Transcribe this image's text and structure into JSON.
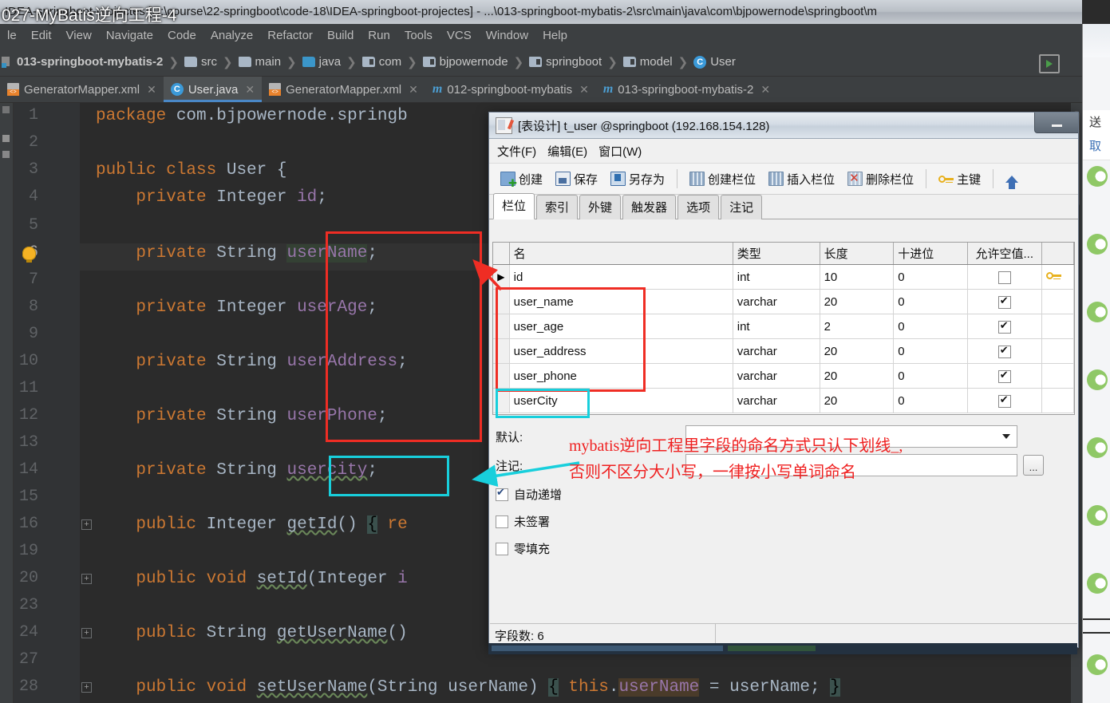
{
  "video_overlay": "027-MyBatis逆向工程-4",
  "ide": {
    "title": "IDEA-springboot-projectes [D:\\course\\22-springboot\\code-18\\IDEA-springboot-projectes] - ...\\013-springboot-mybatis-2\\src\\main\\java\\com\\bjpowernode\\springboot\\m",
    "menu": [
      "le",
      "Edit",
      "View",
      "Navigate",
      "Code",
      "Analyze",
      "Refactor",
      "Build",
      "Run",
      "Tools",
      "VCS",
      "Window",
      "Help"
    ],
    "breadcrumb": [
      {
        "label": "013-springboot-mybatis-2",
        "icon": "module-icon"
      },
      {
        "label": "src",
        "icon": "folder-icon"
      },
      {
        "label": "main",
        "icon": "folder-icon"
      },
      {
        "label": "java",
        "icon": "folder-blue-icon"
      },
      {
        "label": "com",
        "icon": "package-icon"
      },
      {
        "label": "bjpowernode",
        "icon": "package-icon"
      },
      {
        "label": "springboot",
        "icon": "package-icon"
      },
      {
        "label": "model",
        "icon": "package-icon"
      },
      {
        "label": "User",
        "icon": "class-icon"
      }
    ],
    "tabs": [
      {
        "label": "GeneratorMapper.xml",
        "icon": "xml-file-icon",
        "active": false
      },
      {
        "label": "User.java",
        "icon": "java-class-icon",
        "active": true
      },
      {
        "label": "GeneratorMapper.xml",
        "icon": "xml-file-icon",
        "active": false
      },
      {
        "label": "012-springboot-mybatis",
        "icon": "maven-module-icon",
        "active": false
      },
      {
        "label": "013-springboot-mybatis-2",
        "icon": "maven-module-icon",
        "active": false
      }
    ],
    "line_numbers": [
      "1",
      "2",
      "3",
      "4",
      "5",
      "6",
      "7",
      "8",
      "9",
      "10",
      "11",
      "12",
      "13",
      "14",
      "15",
      "16",
      "19",
      "20",
      "23",
      "24",
      "27",
      "28"
    ],
    "code_lines": [
      "package com.bjpowernode.springb",
      "",
      "public class User {",
      "    private Integer id;",
      "",
      "    private String userName;",
      "",
      "    private Integer userAge;",
      "",
      "    private String userAddress;",
      "",
      "    private String userPhone;",
      "",
      "    private String usercity;",
      "",
      "    public Integer getId() { re",
      "",
      "    public void setId(Integer i",
      "",
      "    public String getUserName()",
      "",
      "    public void setUserName(String userName) { this.userName = userName; }"
    ]
  },
  "dialog": {
    "title": "[表设计] t_user @springboot (192.168.154.128)",
    "menu": [
      "文件(F)",
      "编辑(E)",
      "窗口(W)"
    ],
    "toolbar": [
      {
        "label": "创建",
        "icon": "new-table-icon"
      },
      {
        "label": "保存",
        "icon": "save-icon"
      },
      {
        "label": "另存为",
        "icon": "save-as-icon"
      },
      {
        "label": "创建栏位",
        "icon": "add-field-icon"
      },
      {
        "label": "插入栏位",
        "icon": "insert-field-icon"
      },
      {
        "label": "删除栏位",
        "icon": "delete-field-icon"
      },
      {
        "label": "主键",
        "icon": "primary-key-icon"
      },
      {
        "label": "",
        "icon": "move-up-icon"
      }
    ],
    "tabs": [
      "栏位",
      "索引",
      "外键",
      "触发器",
      "选项",
      "注记"
    ],
    "active_tab": "栏位",
    "grid": {
      "columns": [
        "名",
        "类型",
        "长度",
        "十进位",
        "允许空值..."
      ],
      "rows": [
        {
          "marker": "▶",
          "name": "id",
          "type": "int",
          "length": "10",
          "decimals": "0",
          "nullable": false,
          "key": "primary-key-icon"
        },
        {
          "marker": "",
          "name": "user_name",
          "type": "varchar",
          "length": "20",
          "decimals": "0",
          "nullable": true,
          "key": ""
        },
        {
          "marker": "",
          "name": "user_age",
          "type": "int",
          "length": "2",
          "decimals": "0",
          "nullable": true,
          "key": ""
        },
        {
          "marker": "",
          "name": "user_address",
          "type": "varchar",
          "length": "20",
          "decimals": "0",
          "nullable": true,
          "key": ""
        },
        {
          "marker": "",
          "name": "user_phone",
          "type": "varchar",
          "length": "20",
          "decimals": "0",
          "nullable": true,
          "key": ""
        },
        {
          "marker": "",
          "name": "userCity",
          "type": "varchar",
          "length": "20",
          "decimals": "0",
          "nullable": true,
          "key": ""
        }
      ]
    },
    "properties": {
      "default_label": "默认:",
      "default_value": "",
      "comment_label": "注记:",
      "comment_value": "",
      "checkboxes": [
        {
          "label": "自动递增",
          "checked": true
        },
        {
          "label": "未签署",
          "checked": false
        },
        {
          "label": "零填充",
          "checked": false
        }
      ],
      "dots_button": "..."
    },
    "status": "字段数: 6"
  },
  "annotations": {
    "line1": "mybatis逆向工程里字段的命名方式只认下划线_,",
    "line2": "否则不区分大小写，一律按小写单词命名",
    "red_color": "#ef2020",
    "box_red_color": "#ef2d24",
    "box_teal_color": "#18cfdc"
  },
  "wechat": {
    "item1": "送",
    "item2": "取"
  }
}
